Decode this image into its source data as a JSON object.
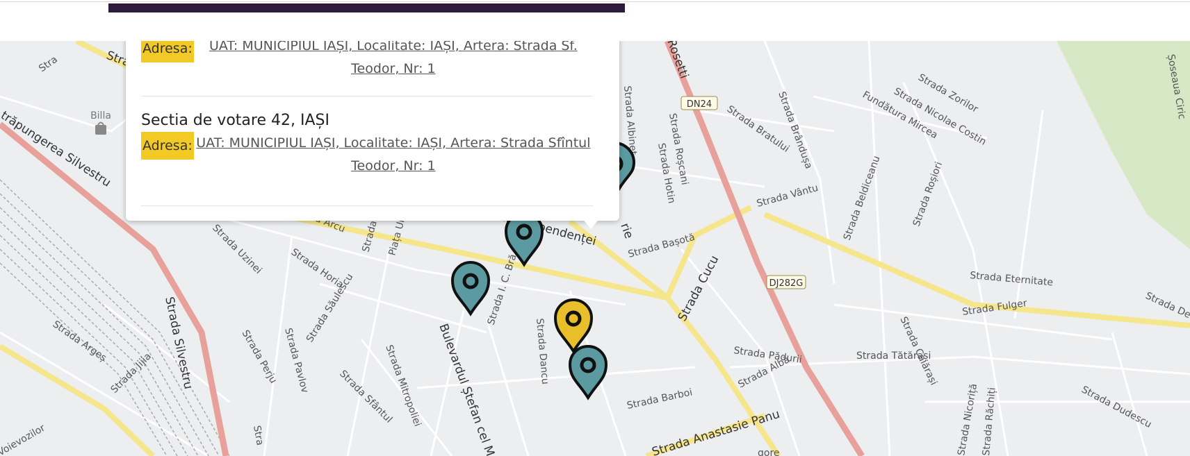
{
  "popup": {
    "entry1": {
      "badge": "Adresa:",
      "address_line1": "UAT: MUNICIPIUL IAȘI, Localitate: IAȘI, Artera: Strada Sf.",
      "address_line2": "Teodor, Nr: 1"
    },
    "entry2": {
      "title": "Sectia de votare 42, IAȘI",
      "badge": "Adresa:",
      "address_line1": "UAT: MUNICIPIUL IAȘI, Localitate: IAȘI, Artera: Strada Sfîntul",
      "address_line2": "Teodor, Nr: 1"
    }
  },
  "map": {
    "streets": {
      "independentei": "ardul Independenței",
      "silvestru": "Strada Silvestru",
      "trapungerea": "trăpungerea Silvestru",
      "cucu": "Strada Cucu",
      "anastasie": "Strada Anastasie Panu",
      "eternitate": "Strada Eternitate",
      "arcu": "Strada Arcu",
      "uzinei": "Strada Uzinei",
      "horia": "Strada Horia",
      "saulescu": "Strada Săulescu",
      "pavlov": "Strada Pavlov",
      "perju": "Strada Perju",
      "arges": "Strada Argeș",
      "jijia": "Strada Jijia",
      "ic_bra": "Strada I. C. Bră",
      "dancu": "Strada Dancu",
      "stefan": "Bulevardul Ștefan cel M",
      "mitropoliei": "Strada Mitropoliei",
      "sfantul": "Strada Sfântul",
      "barboi": "Strada Barboi",
      "padurii": "Strada Pădurii",
      "alba": "Strada Albă",
      "fulger": "Strada Fulger",
      "tatarasi": "Strada Tătărași",
      "caiarasi": "Strada Caiărași",
      "basota": "Strada Bașotă",
      "vantu": "Strada Vântu",
      "beldiceanu": "Strada Beldiceanu",
      "rosiori": "Strada Roșiori",
      "bratului": "Strada Bratului",
      "brandusa": "Strada Brândușa",
      "roscani": "Strada Roșcani",
      "hotin": "Strada Hotin",
      "albinet": "Strada Albineț",
      "zorilor": "Strada Zorilor",
      "costin": "Strada Nicolae Costin",
      "mircea": "Fundătura Mircea",
      "ciric": "Șoseaua Ciric",
      "rosetti": "Rosetti",
      "piata": "Piața Unirii",
      "dudescu": "Strada Dudescu",
      "nicorita": "Strada Nicoriță",
      "rachiti": "Strada Răchiți",
      "vozilor": "Voievozilor",
      "str_clip": "Stra",
      "str_clip2": "Strada Sf",
      "dela": "Strada De la",
      "strada_i": "Strada I",
      "ie": "rie",
      "gore": "gore"
    },
    "road_badges": {
      "dn24": "DN24",
      "dj282g": "DJ282G"
    },
    "poi": {
      "billa": "Billa"
    },
    "markers": [
      {
        "name": "marker-teal-1",
        "color": "#5a9aa0"
      },
      {
        "name": "marker-teal-2",
        "color": "#5a9aa0"
      },
      {
        "name": "marker-yellow",
        "color": "#e8bf2a"
      },
      {
        "name": "marker-teal-3",
        "color": "#5a9aa0"
      },
      {
        "name": "marker-teal-partial",
        "color": "#5a9aa0"
      }
    ]
  },
  "colors": {
    "progress_bar": "#2d1b3d",
    "badge": "#f2c925",
    "marker_teal": "#5a9aa0",
    "marker_yellow": "#e8bf2a",
    "main_road": "#e8a19a",
    "secondary_road": "#f5e68c"
  }
}
